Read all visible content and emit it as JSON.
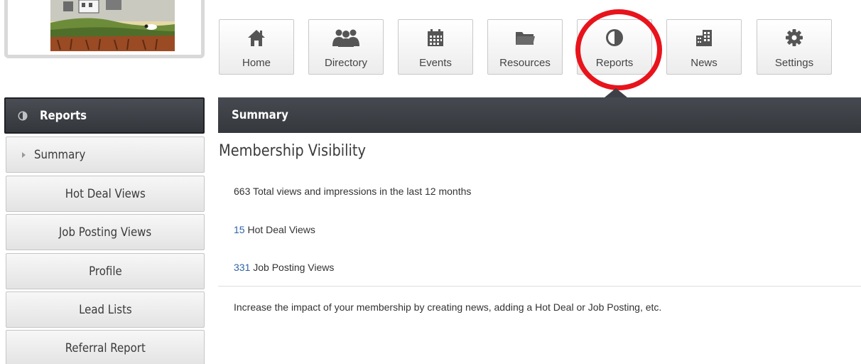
{
  "nav": {
    "items": [
      {
        "label": "Home",
        "icon": "home-icon"
      },
      {
        "label": "Directory",
        "icon": "people-icon"
      },
      {
        "label": "Events",
        "icon": "calendar-icon"
      },
      {
        "label": "Resources",
        "icon": "folder-icon"
      },
      {
        "label": "Reports",
        "icon": "pie-chart-icon"
      },
      {
        "label": "News",
        "icon": "building-icon"
      },
      {
        "label": "Settings",
        "icon": "gear-icon"
      }
    ],
    "active": "Reports"
  },
  "sidebar": {
    "header": "Reports",
    "items": [
      {
        "label": "Summary"
      },
      {
        "label": "Hot Deal Views"
      },
      {
        "label": "Job Posting Views"
      },
      {
        "label": "Profile"
      },
      {
        "label": "Lead Lists"
      },
      {
        "label": "Referral Report"
      }
    ]
  },
  "panel": {
    "header": "Summary",
    "section_title": "Membership Visibility",
    "stats": [
      {
        "value": "663",
        "text": "Total views and impressions in the last 12 months"
      },
      {
        "value": "15",
        "text": "Hot Deal Views"
      },
      {
        "value": "331",
        "text": "Job Posting Views"
      }
    ],
    "note": "Increase the impact of your membership by creating news, adding a Hot Deal or Job Posting, etc."
  },
  "colors": {
    "header_bg": "#3d4147",
    "link_blue": "#2e63a8",
    "highlight_red": "#e8141c"
  }
}
